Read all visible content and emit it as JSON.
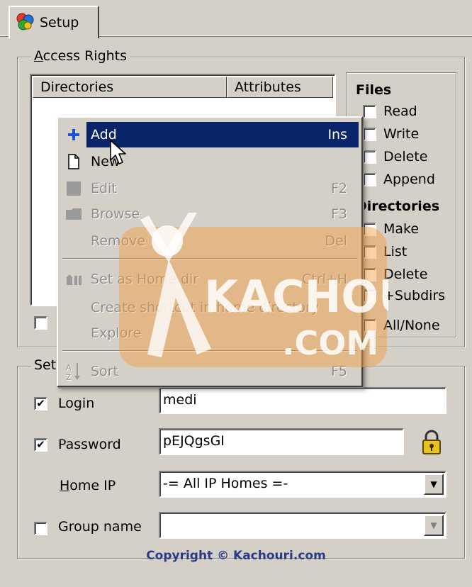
{
  "tab": {
    "label": "Setup"
  },
  "access_rights": {
    "legend_prefix": "A",
    "legend_rest": "ccess Rights",
    "columns": [
      "Directories",
      "Attributes"
    ],
    "files_head": "Files",
    "files": [
      "Read",
      "Write",
      "Delete",
      "Append"
    ],
    "dirs_head": "Directories",
    "dirs": [
      "Make",
      "List",
      "Delete",
      "+Subdirs"
    ],
    "all_none": "All/None"
  },
  "context_menu": {
    "items": [
      {
        "label": "Add",
        "key": "Ins",
        "icon": "plus-icon",
        "state": "active"
      },
      {
        "label": "New",
        "key": "",
        "icon": "new-document-icon",
        "state": "enabled"
      },
      {
        "label": "Edit",
        "key": "F2",
        "icon": "edit-icon",
        "state": "disabled"
      },
      {
        "label": "Browse",
        "key": "F3",
        "icon": "browse-icon",
        "state": "disabled"
      },
      {
        "label": "Remove",
        "key": "Del",
        "icon": "",
        "state": "disabled"
      },
      {
        "label": "Set as Home dir",
        "key": "Ctrl+H",
        "icon": "home-dir-icon",
        "state": "disabled"
      },
      {
        "label": "Create shortcut in home directory",
        "key": "",
        "icon": "",
        "state": "disabled"
      },
      {
        "label": "Explore",
        "key": "",
        "icon": "",
        "state": "disabled"
      },
      {
        "label": "Sort",
        "key": "F5",
        "icon": "sort-az-icon",
        "state": "disabled"
      }
    ]
  },
  "settings": {
    "legend": "Set",
    "login_label": "Login",
    "login_value": "medi",
    "password_label": "Password",
    "password_value": "pEJQgsGI",
    "home_ip_prefix": "H",
    "home_ip_rest": "ome IP",
    "home_ip_value": "-= All IP Homes =-",
    "group_label": "Group name",
    "group_value": ""
  },
  "watermark": {
    "line1": "KACHOURI",
    "line2": ".COM"
  },
  "footer": {
    "copyright": "Copyright © Kachouri.com"
  },
  "colors": {
    "face": "#d4d0c8",
    "highlight": "#0a246a",
    "plus": "#1a4fd6",
    "watermark": "#f39c3c"
  }
}
